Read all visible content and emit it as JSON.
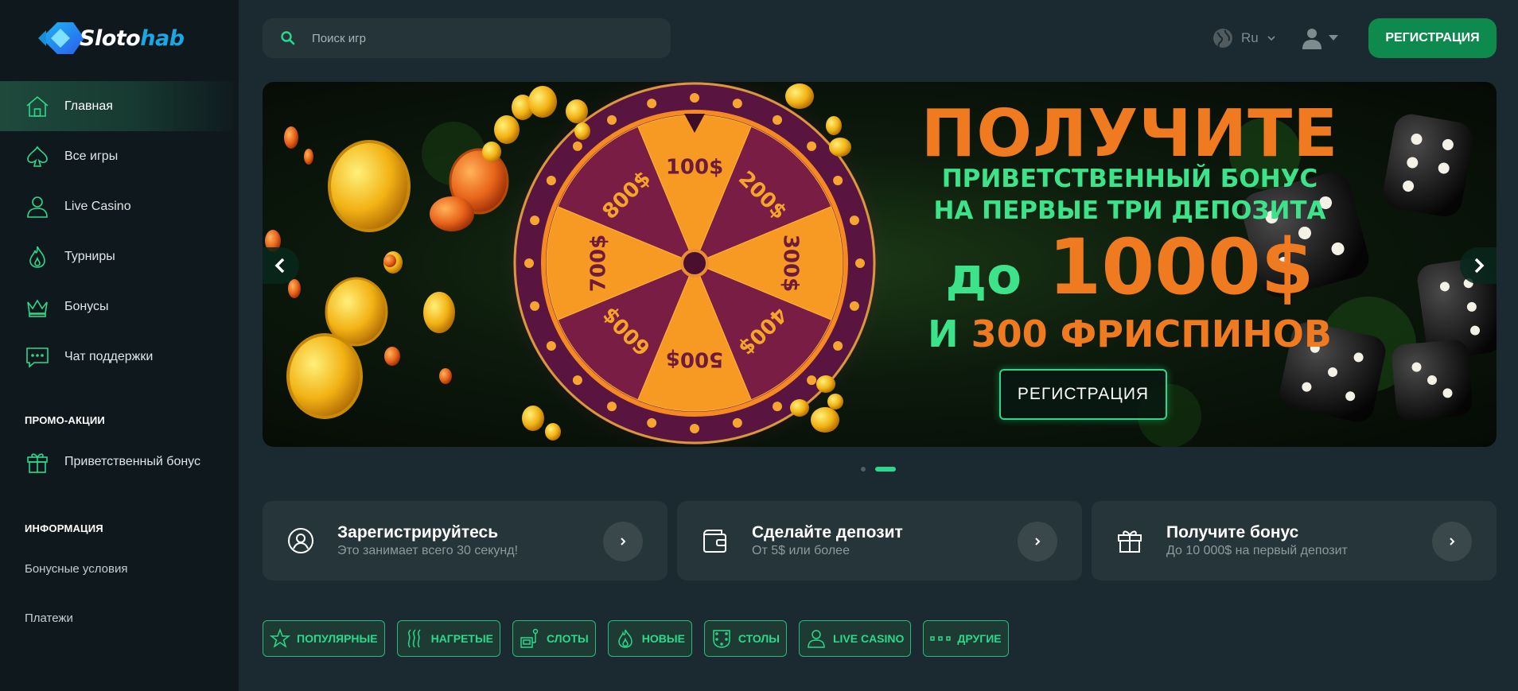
{
  "brand": {
    "name_part1": "Sloto",
    "name_part2": "hab"
  },
  "sidebar": {
    "nav": [
      {
        "label": "Главная",
        "icon": "home-icon",
        "active": true
      },
      {
        "label": "Все игры",
        "icon": "spade-icon"
      },
      {
        "label": "Live Casino",
        "icon": "dealer-icon"
      },
      {
        "label": "Турниры",
        "icon": "flame-icon"
      },
      {
        "label": "Бонусы",
        "icon": "crown-icon"
      },
      {
        "label": "Чат поддержки",
        "icon": "chat-icon"
      }
    ],
    "promo_title": "ПРОМО-АКЦИИ",
    "promo_item": "Приветственный бонус",
    "info_title": "ИНФОРМАЦИЯ",
    "info_links": [
      "Бонусные условия",
      "Платежи"
    ]
  },
  "header": {
    "search_placeholder": "Поиск игр",
    "language": "Ru",
    "register_label": "РЕГИСТРАЦИЯ"
  },
  "banner": {
    "line1": "ПОЛУЧИТЕ",
    "line2a": "ПРИВЕТСТВЕННЫЙ БОНУС",
    "line2b": "НА ПЕРВЫЕ ТРИ ДЕПОЗИТА",
    "line3_prefix": "до",
    "line3_amount": "1000$",
    "line4_prefix": "И",
    "line4_rest": "300 ФРИСПИНОВ",
    "cta": "РЕГИСТРАЦИЯ",
    "wheel_values": [
      "100$",
      "200$",
      "300$",
      "400$",
      "500$",
      "600$",
      "700$",
      "800$"
    ],
    "slides_total": 2,
    "active_slide": 2
  },
  "steps": [
    {
      "title": "Зарегистрируйтесь",
      "subtitle": "Это занимает всего 30 секунд!",
      "icon": "user-circle-icon"
    },
    {
      "title": "Сделайте депозит",
      "subtitle": "От 5$ или более",
      "icon": "wallet-icon"
    },
    {
      "title": "Получите бонус",
      "subtitle": "До 10 000$ на первый депозит",
      "icon": "gift-icon"
    }
  ],
  "categories": [
    {
      "label": "ПОПУЛЯРНЫЕ",
      "icon": "star-icon"
    },
    {
      "label": "НАГРЕТЫЕ",
      "icon": "heat-icon"
    },
    {
      "label": "СЛОТЫ",
      "icon": "slot-lever-icon"
    },
    {
      "label": "НОВЫЕ",
      "icon": "flame-icon"
    },
    {
      "label": "СТОЛЫ",
      "icon": "table-icon"
    },
    {
      "label": "LIVE CASINO",
      "icon": "dealer-icon"
    },
    {
      "label": "ДРУГИЕ",
      "icon": "dots-icon"
    }
  ],
  "colors": {
    "accent": "#2bd98c",
    "button": "#0e8a4f",
    "banner_orange": "#f07a20",
    "sidebar_bg": "#0f191d",
    "page_bg": "#1a2a30"
  }
}
